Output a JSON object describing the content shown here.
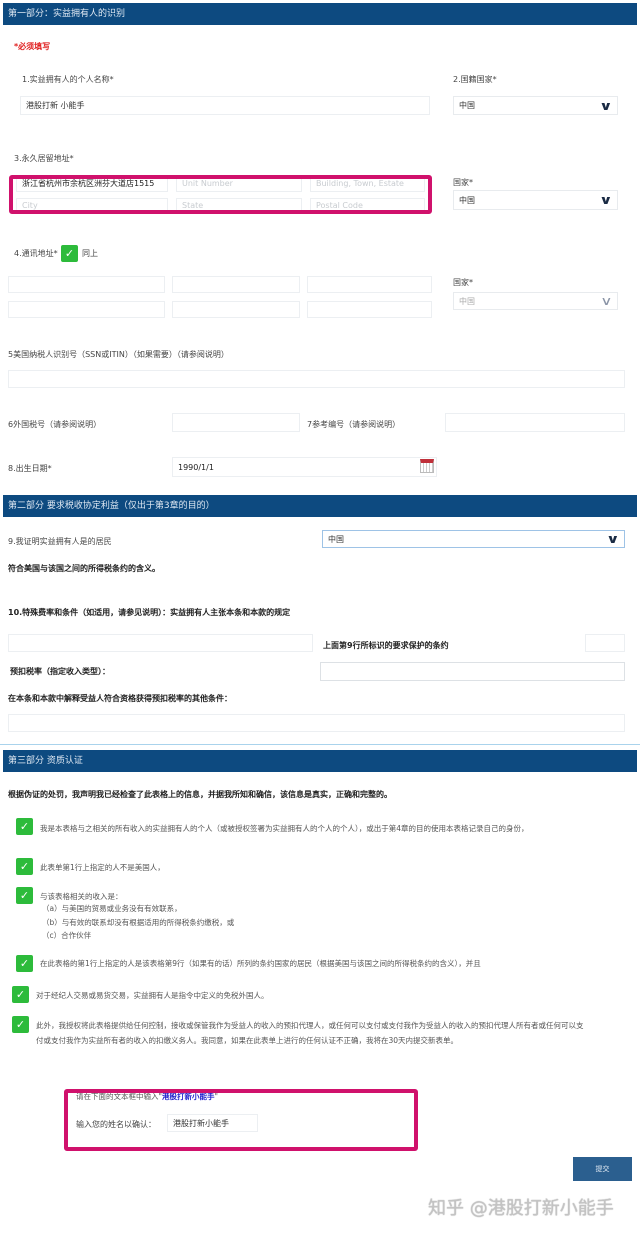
{
  "part1": {
    "title": "第一部分：实益拥有人的识别",
    "required_note": "*必须填写",
    "name_label": "1.实益拥有人的个人名称*",
    "name_value": "港股打新 小能手",
    "citizenship_label": "2.国籍国家*",
    "citizenship_value": "中国",
    "address_label": "3.永久居留地址*",
    "address_street": "浙江省杭州市余杭区洲芬大道店1515",
    "unit_placeholder": "Unit Number",
    "building_placeholder": "Building, Town, Estate",
    "city_placeholder": "City",
    "state_placeholder": "State",
    "postal_placeholder": "Postal Code",
    "country_label": "国家*",
    "country_value": "中国",
    "mailing_label": "4.通讯地址*",
    "same_as_above": "同上",
    "mailing_country_label": "国家*",
    "mailing_country_value": "中国",
    "ssn_label": "5美国纳税人识别号（SSN或ITIN）（如果需要）（请参阅说明）",
    "foreign_tin_label": "6外国税号（请参阅说明）",
    "reference_label": "7参考编号（请参阅说明）",
    "dob_label": "8.出生日期*",
    "dob_value": "1990/1/1"
  },
  "part2": {
    "title": "第二部分 要求税收协定利益（仅出于第3章的目的）",
    "residence_label": "9.我证明实益拥有人是的居民",
    "residence_value": "中国",
    "treaty_meaning": "符合美国与该国之间的所得税条约的含义。",
    "special_rates_label": "10.特殊费率和条件（如适用，请参见说明）：实益拥有人主张本条和本款的规定",
    "treaty_label": "上面第9行所标识的要求保护的条约",
    "withholding_label": "预扣税率（指定收入类型）：",
    "other_conditions_label": "在本条和本款中解释受益人符合资格获得预扣税率的其他条件："
  },
  "part3": {
    "title": "第三部分 资质认证",
    "statement": "根据伪证的处罚，我声明我已经检查了此表格上的信息，并据我所知和确信，该信息是真实，正确和完整的。",
    "items": [
      "我是本表格与之相关的所有收入的实益拥有人的个人（或被授权签署为实益拥有人的个人的个人），或出于第4章的目的使用本表格记录自己的身份，",
      "此表单第1行上指定的人不是美国人，",
      "与该表格相关的收入是：",
      "在此表格的第1行上指定的人是该表格第9行（如果有的话）所列的条约国家的居民（根据美国与该国之间的所得税条约的含义），并且",
      "对于经纪人交易或易货交易，实益拥有人是指令中定义的免税外国人。",
      "此外，我授权将此表格提供给任何控制，接收或保管我作为受益人的收入的预扣代理人，或任何可以支付或支付我作为受益人的收入的预扣代理人所有者或任何可以支付或支付我作为实益所有者的收入的扣缴义务人。我同意，如果在此表单上进行的任何认证不正确，我将在30天内提交新表单。"
    ],
    "subitems": [
      "（a）与美国的贸易或业务没有有效联系，",
      "（b）与有效的联系却没有根据适用的所得税条约缴税，或",
      "（c）合作伙伴"
    ],
    "enter_prompt": "请在下面的文本框中输入\"",
    "enter_name": "港股打新小能手",
    "enter_close": "\"",
    "confirm_label": "输入您的姓名以确认：",
    "confirm_value": "港股打新小能手",
    "submit": "提交"
  },
  "watermark": "知乎 @港股打新小能手"
}
